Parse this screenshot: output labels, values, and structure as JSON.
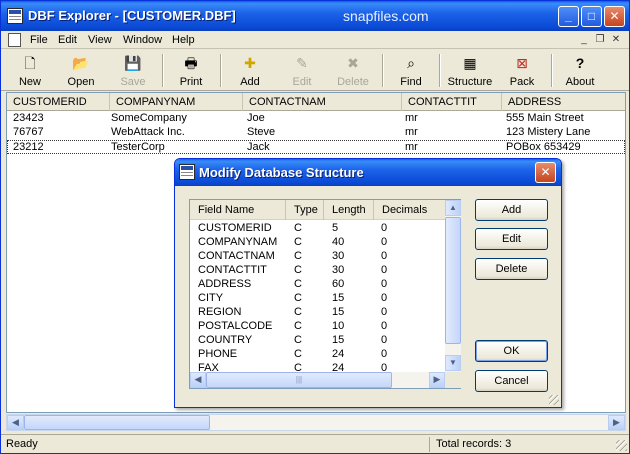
{
  "window": {
    "app_name": "DBF Explorer",
    "title": "DBF Explorer - [CUSTOMER.DBF]",
    "watermark": "snapfiles.com",
    "controls": {
      "minimize": "_",
      "maximize": "□",
      "close": "✕"
    }
  },
  "menu": {
    "items": [
      "File",
      "Edit",
      "View",
      "Window",
      "Help"
    ],
    "mdi_controls": {
      "minimize": "_",
      "restore": "❐",
      "close": "✕"
    }
  },
  "toolbar": {
    "buttons": [
      {
        "label": "New",
        "icon": "new-file-icon",
        "glyph": "🗋",
        "enabled": true
      },
      {
        "label": "Open",
        "icon": "open-folder-icon",
        "glyph": "📂",
        "enabled": true
      },
      {
        "label": "Save",
        "icon": "save-disk-icon",
        "glyph": "💾",
        "enabled": false
      },
      {
        "label": "Print",
        "icon": "printer-icon",
        "glyph": "🖶",
        "enabled": true
      },
      {
        "label": "Add",
        "icon": "add-record-icon",
        "glyph": "✚",
        "enabled": true
      },
      {
        "label": "Edit",
        "icon": "edit-record-icon",
        "glyph": "✎",
        "enabled": false
      },
      {
        "label": "Delete",
        "icon": "delete-record-icon",
        "glyph": "✖",
        "enabled": false
      },
      {
        "label": "Find",
        "icon": "binoculars-icon",
        "glyph": "⌕",
        "enabled": true
      },
      {
        "label": "Structure",
        "icon": "structure-icon",
        "glyph": "▦",
        "enabled": true
      },
      {
        "label": "Pack",
        "icon": "pack-icon",
        "glyph": "⊠",
        "enabled": true
      },
      {
        "label": "About",
        "icon": "help-question-icon",
        "glyph": "?",
        "enabled": true
      }
    ]
  },
  "grid": {
    "columns": [
      "CUSTOMERID",
      "COMPANYNAM",
      "CONTACTNAM",
      "CONTACTTIT",
      "ADDRESS"
    ],
    "rows": [
      [
        "23423",
        "SomeCompany",
        "Joe",
        "mr",
        "555 Main Street"
      ],
      [
        "76767",
        "WebAttack Inc.",
        "Steve",
        "mr",
        "123 Mistery Lane"
      ],
      [
        "23212",
        "TesterCorp",
        "Jack",
        "mr",
        "POBox 653429"
      ]
    ],
    "selected_row": 2
  },
  "status": {
    "left": "Ready",
    "right": "Total records: 3"
  },
  "dialog": {
    "title": "Modify Database Structure",
    "columns": [
      "Field Name",
      "Type",
      "Length",
      "Decimals"
    ],
    "fields": [
      [
        "CUSTOMERID",
        "C",
        "5",
        "0"
      ],
      [
        "COMPANYNAM",
        "C",
        "40",
        "0"
      ],
      [
        "CONTACTNAM",
        "C",
        "30",
        "0"
      ],
      [
        "CONTACTTIT",
        "C",
        "30",
        "0"
      ],
      [
        "ADDRESS",
        "C",
        "60",
        "0"
      ],
      [
        "CITY",
        "C",
        "15",
        "0"
      ],
      [
        "REGION",
        "C",
        "15",
        "0"
      ],
      [
        "POSTALCODE",
        "C",
        "10",
        "0"
      ],
      [
        "COUNTRY",
        "C",
        "15",
        "0"
      ],
      [
        "PHONE",
        "C",
        "24",
        "0"
      ],
      [
        "FAX",
        "C",
        "24",
        "0"
      ]
    ],
    "buttons": {
      "add": "Add",
      "edit": "Edit",
      "delete": "Delete",
      "ok": "OK",
      "cancel": "Cancel"
    },
    "close": "✕"
  },
  "scroll": {
    "left": "◀",
    "right": "▶",
    "up": "▲",
    "down": "▼",
    "grip": "|||"
  },
  "colors": {
    "title_bar": "#0a49d4",
    "accent_border": "#0831d9",
    "face": "#ece9d8",
    "close_button": "#c4441e"
  }
}
